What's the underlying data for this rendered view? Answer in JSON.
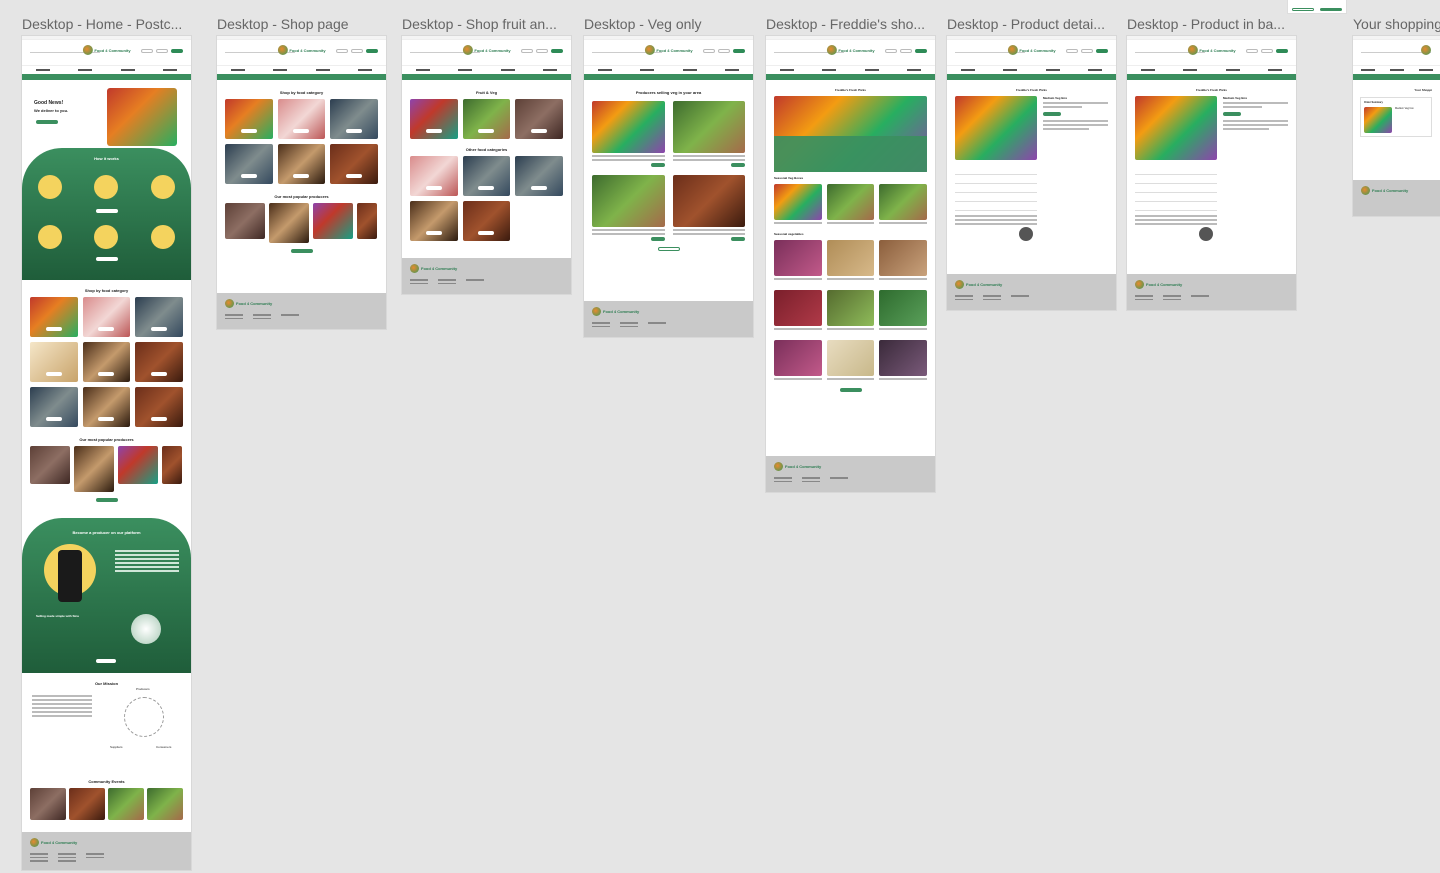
{
  "frames": [
    {
      "title": "Desktop - Home - Postc..."
    },
    {
      "title": "Desktop - Shop page"
    },
    {
      "title": "Desktop - Shop fruit an..."
    },
    {
      "title": "Desktop - Veg only"
    },
    {
      "title": "Desktop - Freddie's sho..."
    },
    {
      "title": "Desktop - Product detai..."
    },
    {
      "title": "Desktop - Product in ba..."
    },
    {
      "title": "Your shopping"
    }
  ],
  "home": {
    "hero_title": "Good News!",
    "hero_sub": "We deliver to you.",
    "how_title": "How it works",
    "shop_cat_title": "Shop by food category",
    "popular_title": "Our most popular producers",
    "become_title": "Become a producer on our platform",
    "selling_title": "Selling made simple with Sina",
    "mission_title": "Our Mission",
    "mission_producers": "Producers",
    "mission_suppliers": "Suppliers",
    "mission_consumers": "Consumers",
    "events_title": "Community Events"
  },
  "shop": {
    "cat_title": "Shop by food category",
    "popular_title": "Our most popular producers"
  },
  "fruit": {
    "title": "Fruit & Veg",
    "other_title": "Other food categories"
  },
  "veg": {
    "title": "Producers selling veg in your area"
  },
  "freddie": {
    "title": "Freddie's Fresh Picks",
    "seasonal_box": "Seasonal Veg Boxes",
    "seasonal_veg": "Seasonal vegetables"
  },
  "detail": {
    "title": "Freddie's Fresh Picks",
    "product": "Medium Veg Box"
  },
  "basket": {
    "title": "Freddie's Fresh Picks",
    "product": "Medium Veg Box"
  },
  "cart": {
    "title": "Your Shoppi",
    "order_summary": "Order Summary",
    "item": "Medium Veg box"
  },
  "brand": {
    "logo_text": "Food 4 Community"
  }
}
